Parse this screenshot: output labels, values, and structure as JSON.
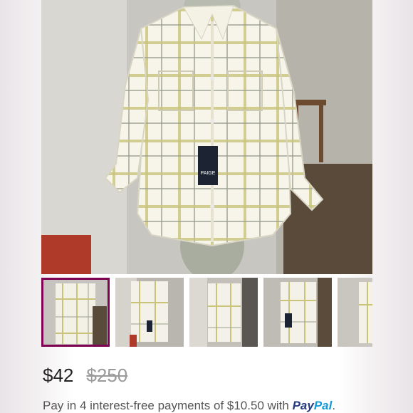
{
  "listing": {
    "thumbnails": [
      {
        "name": "thumb-1",
        "selected": true
      },
      {
        "name": "thumb-2",
        "selected": false
      },
      {
        "name": "thumb-3",
        "selected": false
      },
      {
        "name": "thumb-4",
        "selected": false
      },
      {
        "name": "thumb-5",
        "selected": false
      }
    ],
    "hang_tag_brand": "PAIGE",
    "price": "$42",
    "original_price": "$250",
    "paypal": {
      "text": "Pay in 4 interest-free payments of $10.50 with",
      "brand_pay": "Pay",
      "brand_pal": "Pal",
      "suffix": "."
    }
  },
  "colors": {
    "selected_thumb_border": "#7f0353",
    "paypal_dark": "#253b80",
    "paypal_light": "#179bd7"
  }
}
